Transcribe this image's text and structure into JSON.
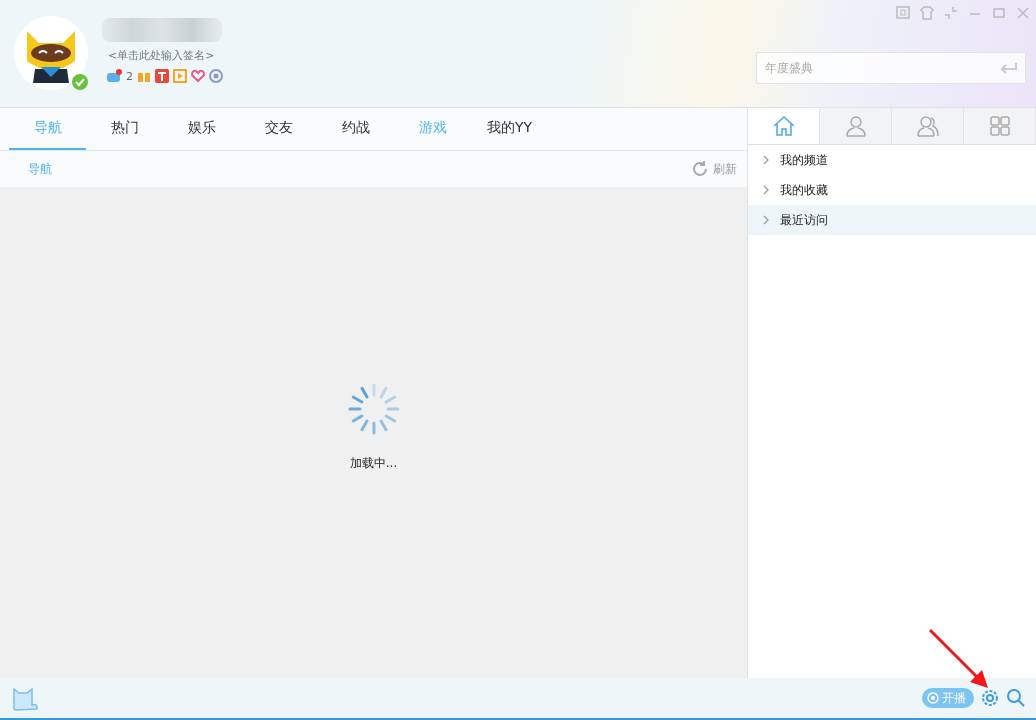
{
  "profile": {
    "signature": "<单击此处输入签名>",
    "online": true,
    "badge_count": "2"
  },
  "search": {
    "placeholder": "年度盛典"
  },
  "tabs": [
    {
      "label": "导航",
      "selected": true,
      "highlighted": false
    },
    {
      "label": "热门",
      "selected": false,
      "highlighted": false
    },
    {
      "label": "娱乐",
      "selected": false,
      "highlighted": false
    },
    {
      "label": "交友",
      "selected": false,
      "highlighted": false
    },
    {
      "label": "约战",
      "selected": false,
      "highlighted": false
    },
    {
      "label": "游戏",
      "selected": false,
      "highlighted": true
    },
    {
      "label": "我的YY",
      "selected": false,
      "highlighted": false
    }
  ],
  "breadcrumb": "导航",
  "refresh": "刷新",
  "loading": "加载中...",
  "side_tabs": [
    {
      "kind": "home",
      "selected": true
    },
    {
      "kind": "person",
      "selected": false
    },
    {
      "kind": "people",
      "selected": false
    },
    {
      "kind": "apps",
      "selected": false
    }
  ],
  "side_items": [
    {
      "label": "我的频道",
      "selected": false
    },
    {
      "label": "我的收藏",
      "selected": false
    },
    {
      "label": "最近访问",
      "selected": true
    }
  ],
  "status_bar": {
    "live_button": "开播"
  }
}
